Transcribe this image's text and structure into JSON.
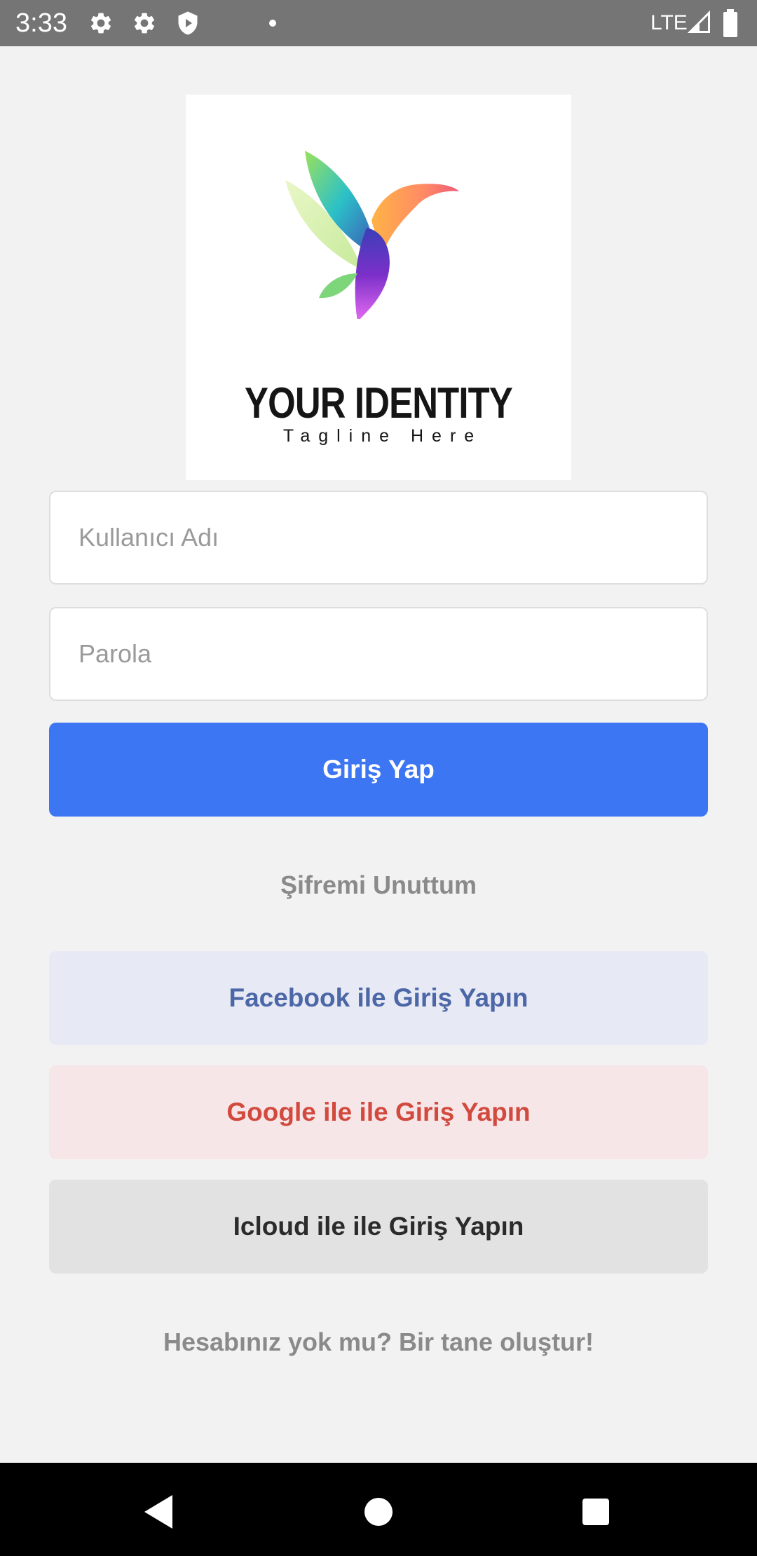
{
  "status_bar": {
    "time": "3:33",
    "network": "LTE",
    "icons": [
      "settings-icon",
      "settings-icon",
      "shield-icon",
      "notification-dot",
      "signal-icon",
      "battery-icon"
    ]
  },
  "logo": {
    "title": "YOUR IDENTITY",
    "tagline": "Tagline Here"
  },
  "form": {
    "username_placeholder": "Kullanıcı Adı",
    "password_placeholder": "Parola",
    "login_label": "Giriş Yap",
    "forgot_label": "Şifremi Unuttum"
  },
  "social": {
    "facebook_label": "Facebook ile Giriş Yapın",
    "google_label": "Google ile ile Giriş Yapın",
    "icloud_label": "Icloud ile ile Giriş Yapın"
  },
  "signup_label": "Hesabınız yok mu? Bir tane oluştur!",
  "colors": {
    "primary": "#3d76f2",
    "facebook_text": "#4c67a7",
    "facebook_bg": "#e7e9f4",
    "google_text": "#d24a3e",
    "google_bg": "#f7e6e8",
    "icloud_text": "#2b2b2b",
    "icloud_bg": "#e2e2e2",
    "background": "#f2f2f2"
  },
  "nav_bar": {
    "icons": [
      "back-icon",
      "home-icon",
      "recents-icon"
    ]
  }
}
